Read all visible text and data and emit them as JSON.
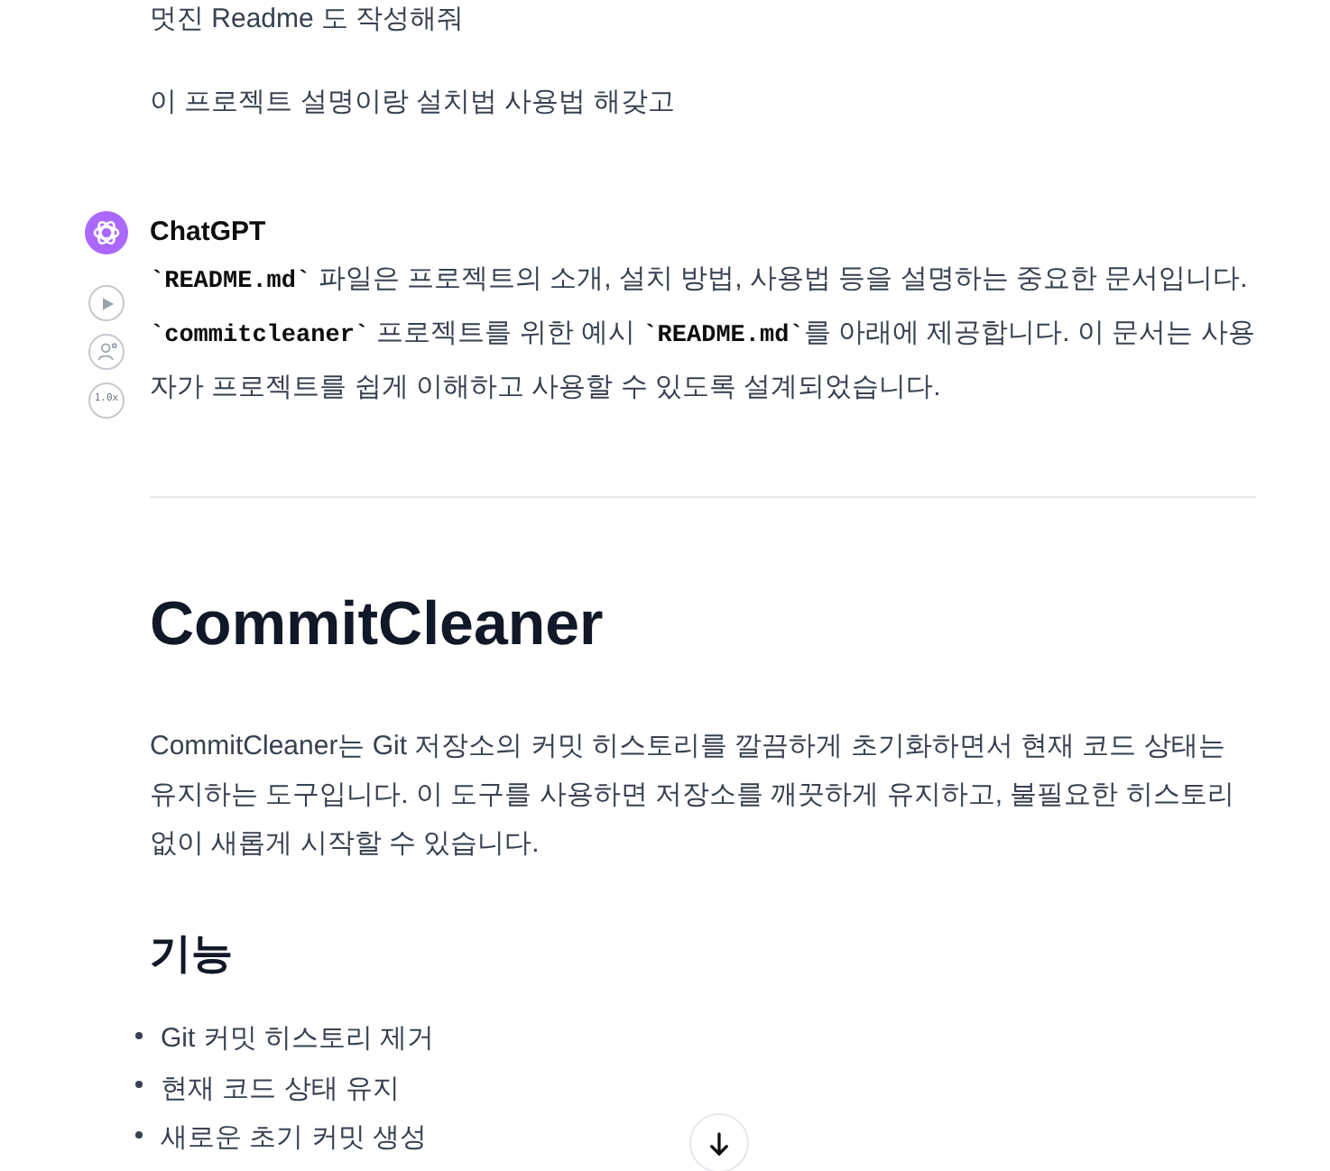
{
  "user_messages": [
    {
      "text": "멋진 Readme 도 작성해줘"
    },
    {
      "text": "이 프로젝트 설명이랑 설치법 사용법 해갖고"
    }
  ],
  "assistant": {
    "name": "ChatGPT",
    "intro": "**`README.md`** 파일은 프로젝트의 소개, 설치 방법, 사용법 등을 설명하는 중요한 문서입니다. **`commitcleaner`** 프로젝트를 위한 예시 **`README.md`**를 아래에 제공합니다. 이 문서는 사용자가 프로젝트를 쉽게 이해하고 사용할 수 있도록 설계되었습니다.",
    "actions": [
      {
        "kind": "play"
      },
      {
        "kind": "voice"
      },
      {
        "kind": "speed",
        "label": "1.0x"
      }
    ]
  },
  "readme": {
    "title": "CommitCleaner",
    "description": "CommitCleaner는 Git 저장소의 커밋 히스토리를 깔끔하게 초기화하면서 현재 코드 상태는 유지하는 도구입니다. 이 도구를 사용하면 저장소를 깨끗하게 유지하고, 불필요한 히스토리 없이 새롭게 시작할 수 있습니다.",
    "sections": [
      {
        "heading": "기능",
        "items": [
          "Git 커밋 히스토리 제거",
          "현재 코드 상태 유지",
          "새로운 초기 커밋 생성"
        ]
      }
    ]
  }
}
